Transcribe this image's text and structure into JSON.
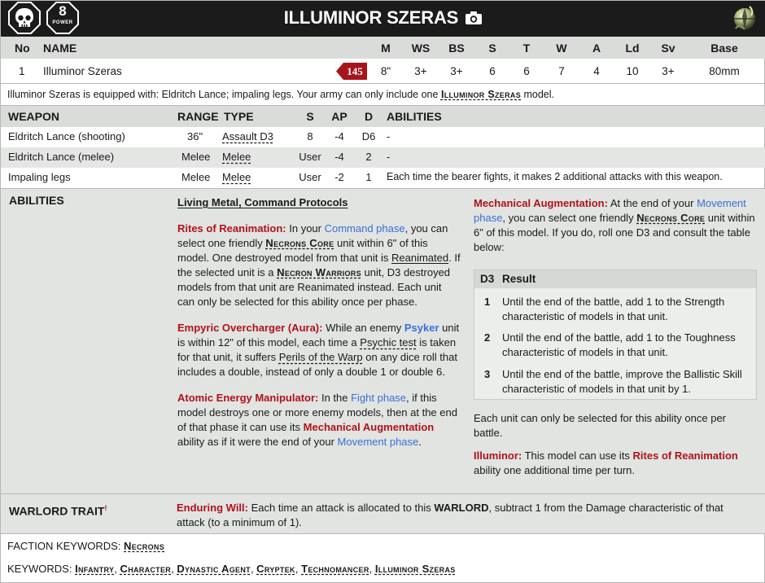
{
  "header": {
    "title": "ILLUMINOR SZERAS",
    "power_value": "8",
    "power_label": "POWER",
    "icons": [
      "skull-icon",
      "power-octagon-icon",
      "camera-icon",
      "necron-faction-icon"
    ]
  },
  "stats": {
    "headers": [
      "No",
      "NAME",
      "M",
      "WS",
      "BS",
      "S",
      "T",
      "W",
      "A",
      "Ld",
      "Sv",
      "Base"
    ],
    "row": [
      "1",
      "Illuminor Szeras",
      "8\"",
      "3+",
      "3+",
      "6",
      "6",
      "7",
      "4",
      "10",
      "3+",
      "80mm"
    ],
    "points": "145"
  },
  "equipment": {
    "prefix": "Illuminor Szeras is equipped with: Eldritch Lance; impaling legs. Your army can only include one ",
    "keyword": "Illuminor Szeras",
    "suffix": " model."
  },
  "weapons": {
    "headers": [
      "WEAPON",
      "RANGE",
      "TYPE",
      "S",
      "AP",
      "D",
      "ABILITIES"
    ],
    "rows": [
      [
        "Eldritch Lance (shooting)",
        "36\"",
        "Assault D3",
        "8",
        "-4",
        "D6",
        "-"
      ],
      [
        "Eldritch Lance (melee)",
        "Melee",
        "Melee",
        "User",
        "-4",
        "2",
        "-"
      ],
      [
        "Impaling legs",
        "Melee",
        "Melee",
        "User",
        "-2",
        "1",
        "Each time the bearer fights, it makes 2 additional attacks with this weapon."
      ]
    ]
  },
  "abilities": {
    "title": "ABILITIES",
    "shared": [
      "Living Metal",
      "Command Protocols"
    ],
    "sep": ", ",
    "rites": {
      "name": "Rites of Reanimation:",
      "t1": " In your ",
      "link1": "Command phase",
      "t2": ", you can select one friendly ",
      "kw1": "Necrons Core",
      "t3": " unit within 6\" of this model. One destroyed model from that unit is ",
      "link2": "Reanimated",
      "t4": ". If the selected unit is a ",
      "kw2": "Necron Warriors",
      "t5": " unit, D3 destroyed models from that unit are Reanimated instead. Each unit can only be selected for this ability once per phase."
    },
    "empyric": {
      "name": "Empyric Overcharger (Aura):",
      "t1": " While an enemy ",
      "kw1": "Psyker",
      "t2": " unit is within 12\" of this model, each time a ",
      "link1": "Psychic test",
      "t3": " is taken for that unit, it suffers ",
      "link2": "Perils of the Warp",
      "t4": " on any dice roll that includes a double, instead of only a double 1 or double 6."
    },
    "atomic": {
      "name": "Atomic Energy Manipulator:",
      "t1": " In the ",
      "link1": "Fight phase",
      "t2": ", if this model destroys one or more enemy models, then at the end of that phase it can use its ",
      "ref": "Mechanical Augmentation",
      "t3": " ability as if it were the end of your ",
      "link2": "Movement phase",
      "t4": "."
    },
    "mech": {
      "name": "Mechanical Augmentation:",
      "t1": " At the end of your ",
      "link1": "Movement phase",
      "t2": ", you can select one friendly ",
      "kw1": "Necrons Core",
      "t3": " unit within 6\" of this model. If you do, roll one D3 and consult the table below:"
    },
    "d3_table": {
      "headers": [
        "D3",
        "Result"
      ],
      "rows": [
        [
          "1",
          "Until the end of the battle, add 1 to the Strength characteristic of models in that unit."
        ],
        [
          "2",
          "Until the end of the battle, add 1 to the Toughness characteristic of models in that unit."
        ],
        [
          "3",
          "Until the end of the battle, improve the Ballistic Skill characteristic of models in that unit by 1."
        ]
      ]
    },
    "once_note": "Each unit can only be selected for this ability once per battle.",
    "illuminor": {
      "name": "Illuminor:",
      "t1": " This model can use its ",
      "ref": "Rites of Reanimation",
      "t2": " ability one additional time per turn."
    }
  },
  "warlord": {
    "title": "WARLORD TRAIT",
    "mark": "!",
    "name": "Enduring Will:",
    "t1": " Each time an attack is allocated to this ",
    "kw": "WARLORD",
    "t2": ", subtract 1 from the Damage characteristic of that attack (to a minimum of 1)."
  },
  "faction_keywords": {
    "label": "FACTION KEYWORDS: ",
    "items": [
      "Necrons"
    ]
  },
  "keywords": {
    "label": "KEYWORDS: ",
    "items": [
      "Infantry",
      "Character",
      "Dynastic Agent",
      "Cryptek",
      "Technomancer",
      "Illuminor Szeras"
    ],
    "sep": ", "
  },
  "colors": {
    "header_bg": "#1b1b1b",
    "row_header_bg": "#d9dcd9",
    "ability_name_red": "#b0121b",
    "link_blue": "#3a6fd8",
    "points_badge": "#a8141c"
  }
}
